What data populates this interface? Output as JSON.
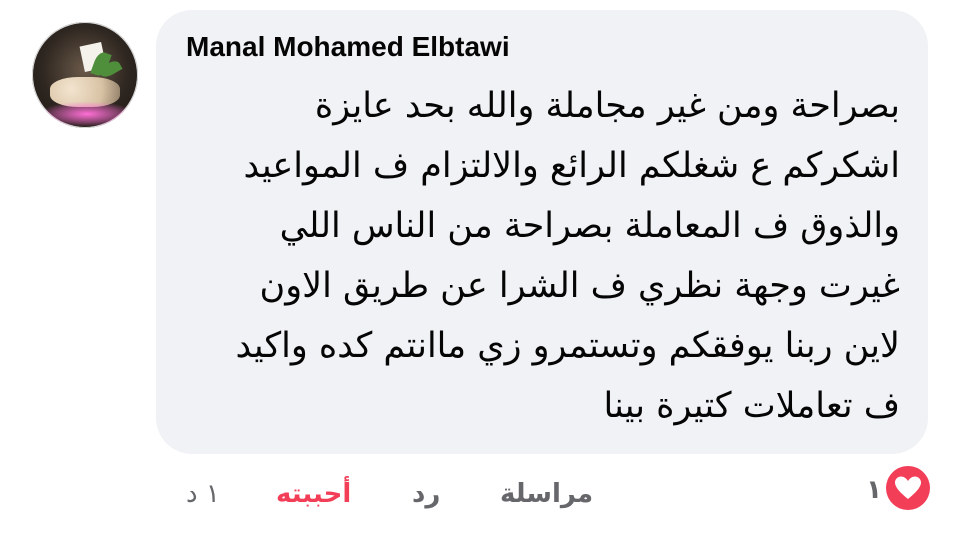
{
  "comment": {
    "author": "Manal Mohamed Elbtawi",
    "lines": [
      "بصراحة ومن غير مجاملة والله بحد عايزة",
      "اشكركم ع شغلكم الرائع والالتزام ف المواعيد",
      "والذوق ف المعاملة بصراحة من الناس اللي",
      "غيرت وجهة نظري ف الشرا عن طريق الاون",
      "لاين ربنا يوفقكم وتستمرو زي ماانتم كده واكيد",
      "ف تعاملات كتيرة بينا"
    ]
  },
  "actions": {
    "message_label": "مراسلة",
    "reply_label": "رد",
    "like_label": "أحببته",
    "time": "١ د",
    "like_color": "#f33e58"
  },
  "reactions": {
    "count": "١",
    "icon": "heart-icon",
    "color": "#f33e58"
  }
}
